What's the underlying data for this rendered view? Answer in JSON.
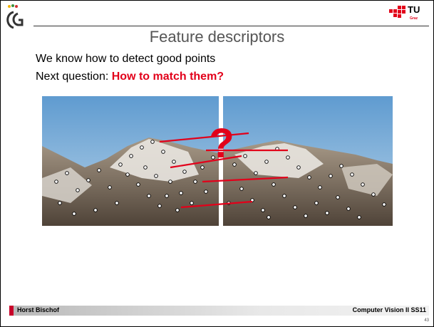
{
  "slide": {
    "title": "Feature descriptors",
    "line1": "We know how to detect good points",
    "line2_prefix": "Next question: ",
    "line2_emphasis": "How to match them?",
    "figure_mark": "?",
    "logo_text": "TU",
    "logo_subtext": "Graz",
    "footer_left": "Horst Bischof",
    "footer_right": "Computer Vision II SS11",
    "page_number": "43",
    "colors": {
      "accent": "#e2001a",
      "footer_accent": "#c8002a",
      "title": "#555555"
    }
  }
}
